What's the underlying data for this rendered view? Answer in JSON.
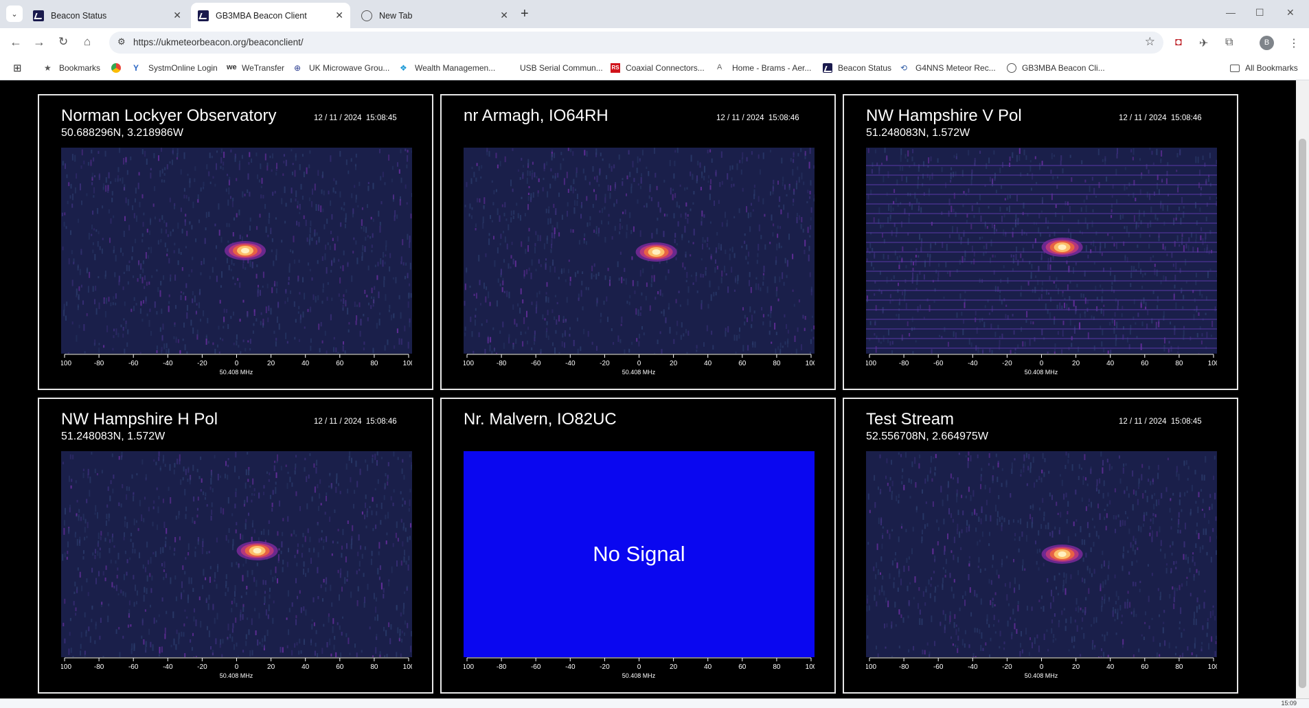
{
  "browser": {
    "tabs": [
      {
        "label": "Beacon Status",
        "icon": "beacon-favicon-icon"
      },
      {
        "label": "GB3MBA Beacon Client",
        "icon": "beacon-favicon-icon",
        "active": true
      },
      {
        "label": "New Tab",
        "icon": "globe-icon"
      }
    ],
    "url": "https://ukmeteorbeacon.org/beaconclient/",
    "profile_initial": "B",
    "bookmarks": [
      {
        "label": "Bookmarks",
        "icon": "star-icon"
      },
      {
        "label": "",
        "icon": "google-drive-icon"
      },
      {
        "label": "SystmOnline Login",
        "icon": "systmonline-icon"
      },
      {
        "label": "WeTransfer",
        "icon": "wetransfer-icon"
      },
      {
        "label": "UK Microwave Grou...",
        "icon": "microwave-group-icon"
      },
      {
        "label": "Wealth Managemen...",
        "icon": "wealth-icon"
      },
      {
        "label": "USB Serial Commun...",
        "icon": "none"
      },
      {
        "label": "Coaxial Connectors...",
        "icon": "rs-icon"
      },
      {
        "label": "Home - Brams - Aer...",
        "icon": "brams-icon"
      },
      {
        "label": "Beacon Status",
        "icon": "beacon-favicon-icon"
      },
      {
        "label": "G4NNS Meteor Rec...",
        "icon": "g4nns-icon"
      },
      {
        "label": "GB3MBA Beacon Cli...",
        "icon": "globe-icon"
      }
    ],
    "all_bookmarks_label": "All Bookmarks"
  },
  "axis": {
    "ticks": [
      "-100",
      "-80",
      "-60",
      "-40",
      "-20",
      "0",
      "20",
      "40",
      "60",
      "80",
      "100"
    ],
    "label": "50.408 MHz"
  },
  "panels": [
    {
      "title": "Norman Lockyer Observatory",
      "coords": "50.688296N, 3.218986W",
      "timestamp": "12 / 11 / 2024  15:08:45",
      "signal": true
    },
    {
      "title": "nr Armagh, IO64RH",
      "coords": "",
      "timestamp": "12 / 11 / 2024  15:08:46",
      "signal": true
    },
    {
      "title": "NW Hampshire V Pol",
      "coords": "51.248083N, 1.572W",
      "timestamp": "12 / 11 / 2024  15:08:46",
      "signal": true
    },
    {
      "title": "NW Hampshire H Pol",
      "coords": "51.248083N, 1.572W",
      "timestamp": "12 / 11 / 2024  15:08:46",
      "signal": true
    },
    {
      "title": "Nr. Malvern, IO82UC",
      "coords": "",
      "timestamp": "",
      "signal": false,
      "no_signal_text": "No Signal"
    },
    {
      "title": "Test Stream",
      "coords": "52.556708N, 2.664975W",
      "timestamp": "12 / 11 / 2024  15:08:45",
      "signal": true
    }
  ],
  "taskbar": {
    "clock": "15:09"
  },
  "colors": {
    "spectrogram_bg": "#1a1f4a",
    "no_signal_bg": "#0a07f0",
    "panel_border": "#e8e8e8"
  }
}
